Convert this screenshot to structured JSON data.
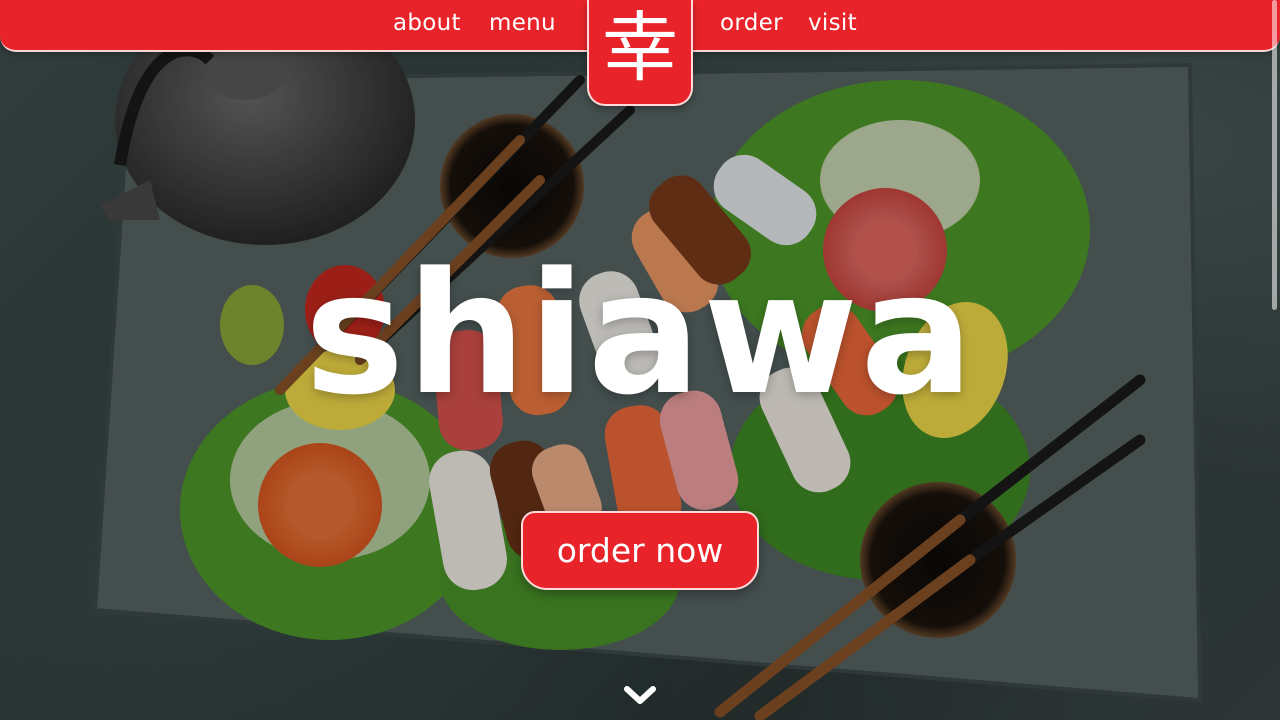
{
  "nav": {
    "links": [
      {
        "label": "about"
      },
      {
        "label": "menu"
      },
      {
        "label": "order"
      },
      {
        "label": "visit"
      }
    ],
    "logo_glyph": "幸",
    "logo_icon": "kanji-logo-icon"
  },
  "hero": {
    "title": "shiawa",
    "cta_label": "order now",
    "scroll_icon": "chevron-down-icon"
  },
  "colors": {
    "brand_red": "#e8232a",
    "border_pink": "#ffd9da",
    "text_white": "#ffffff"
  }
}
